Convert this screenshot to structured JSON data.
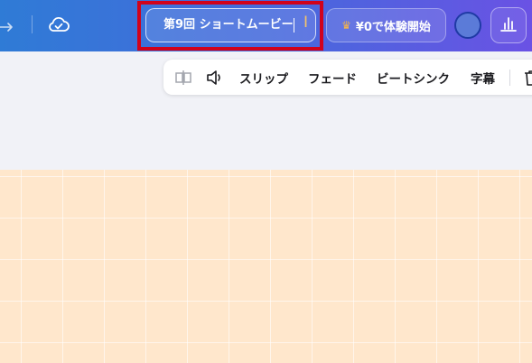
{
  "topbar": {
    "title_value": "第9回 ショートムービー",
    "trial_label": "¥0で体験開始",
    "icons": [
      "redo-icon",
      "cloud-check-icon",
      "crown-icon",
      "bar-chart-icon"
    ],
    "colors": {
      "gradient_start": "#2f7bd6",
      "gradient_end": "#6a52e4",
      "highlight_box": "#d0021b",
      "crown": "#f3b34d"
    }
  },
  "toolbar": {
    "slip": "スリップ",
    "fade": "フェード",
    "beat_sync": "ビートシンク",
    "subtitles": "字幕",
    "icons": [
      "split-icon",
      "volume-icon",
      "trash-icon"
    ]
  },
  "canvas": {
    "background_color": "#ffe7cc"
  }
}
